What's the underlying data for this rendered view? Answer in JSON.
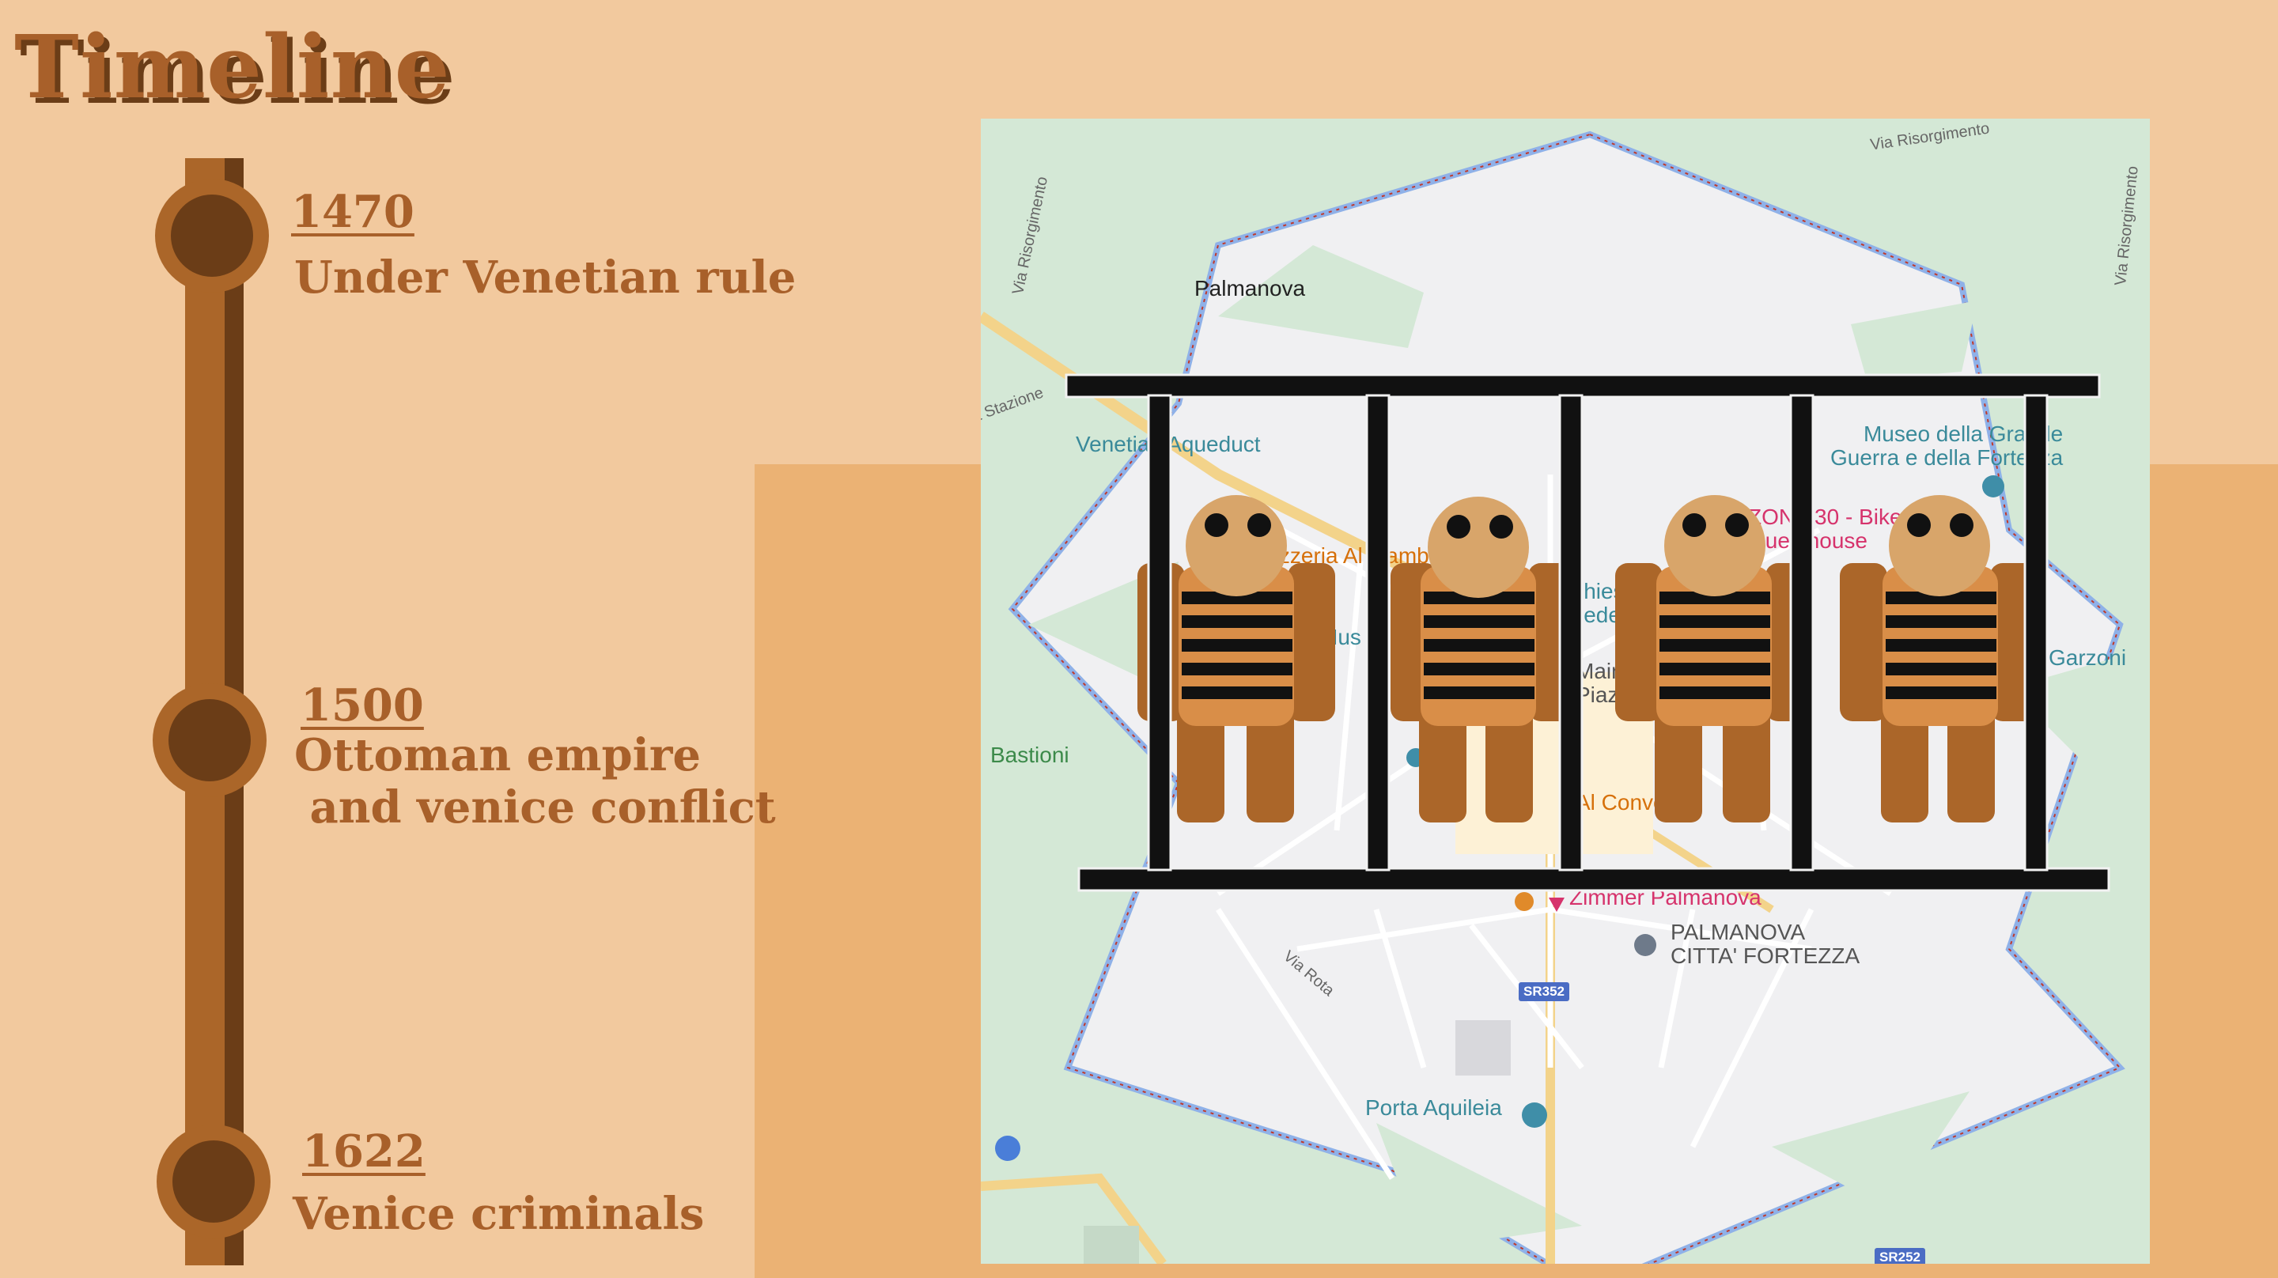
{
  "slide": {
    "title": "Timeline",
    "colors": {
      "background": "#f2c99e",
      "panel": "#ebb274",
      "accent": "#ab6629",
      "dark": "#6b3d17"
    }
  },
  "timeline": [
    {
      "year": "1470",
      "text": "Under Venetian rule"
    },
    {
      "year": "1500",
      "text": "Ottoman empire\n and venice conflict"
    },
    {
      "year": "1622",
      "text": "Venice criminals"
    }
  ],
  "map": {
    "town": "Palmanova",
    "places": {
      "aqueduct": "Venetian Aqueduct",
      "museum": "Museo della Grande\nGuerra e della Fortezza",
      "zona": "ZONA 30 - Bike\nGuesthouse",
      "pizzeria": "Pizzeria Al Gambero",
      "bastioni": "Bastioni",
      "garzoni": "Garzoni",
      "zimmer": "Zimmer Palmanova",
      "fortezza": "PALMANOVA\nCITTA' FORTEZZA",
      "porta": "Porta Aquileia",
      "al_convento": "Al Convento",
      "mus": "Mus",
      "chiesa": "Chiesa\nRedentore",
      "main_piazza": "Main\nPiazza"
    },
    "roads": {
      "risorgimento_1": "Via Risorgimento",
      "risorgimento_2": "Via Risorgimento",
      "risorgimento_3": "Via Risorgimento",
      "stazione": "Via Stazione",
      "rota": "Via Rota",
      "sr352": "SR352",
      "sr252": "SR252"
    }
  },
  "illustration": {
    "subject": "prisoners-behind-bars",
    "prisoner_count": 4,
    "bar_count": 5
  }
}
